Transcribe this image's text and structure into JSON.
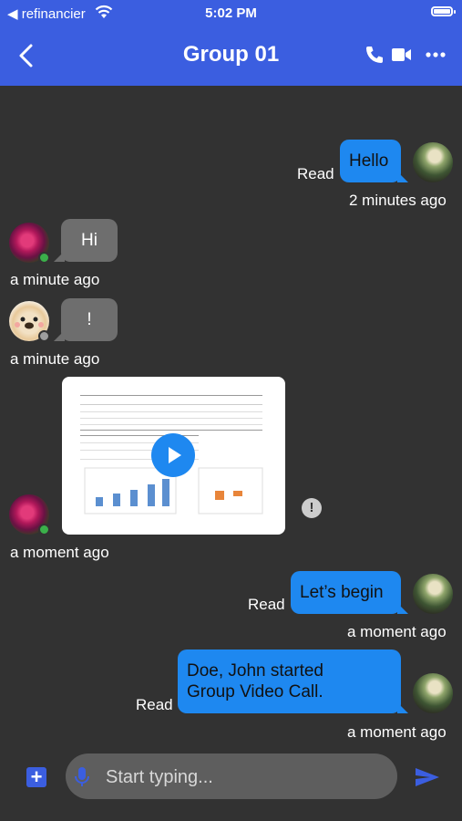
{
  "status_bar": {
    "back_app_label": "◀ refinancier",
    "time": "5:02 PM"
  },
  "header": {
    "title": "Group 01"
  },
  "colors": {
    "accent": "#3b5ee0",
    "outgoing_bubble": "#1e88f0",
    "incoming_bubble": "#6e6e6e",
    "background": "#323232",
    "online": "#3bb04a",
    "offline": "#9e9e9e"
  },
  "messages": [
    {
      "direction": "out",
      "text": "Hello",
      "status": "Read",
      "time": "2 minutes ago"
    },
    {
      "direction": "in",
      "text": "Hi",
      "time": "a minute ago",
      "presence": "online"
    },
    {
      "direction": "in",
      "text": "!",
      "time": "a minute ago",
      "presence": "offline"
    },
    {
      "direction": "in",
      "type": "video",
      "time": "a moment ago",
      "presence": "online",
      "error_icon": "exclamation-circle-icon"
    },
    {
      "direction": "out",
      "text": "Let’s begin",
      "status": "Read",
      "time": "a moment ago"
    },
    {
      "direction": "out",
      "text_lines": [
        "Doe, John started",
        "Group Video Call."
      ],
      "status": "Read",
      "time": "a moment ago"
    }
  ],
  "composer": {
    "placeholder": "Start typing..."
  },
  "icons": [
    "chevron-left-icon",
    "phone-icon",
    "video-camera-icon",
    "more-icon",
    "add-icon",
    "microphone-icon",
    "send-icon",
    "play-icon",
    "wifi-icon",
    "battery-icon"
  ]
}
